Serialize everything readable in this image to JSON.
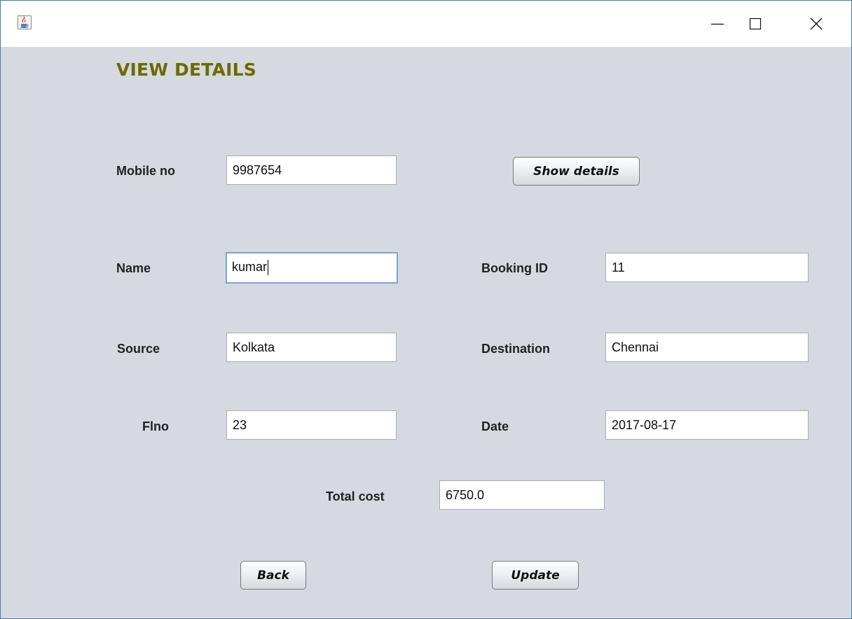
{
  "window": {
    "icon": "java-cup-icon",
    "controls": {
      "minimize": "minimize-icon",
      "maximize": "maximize-icon",
      "close": "close-icon"
    }
  },
  "heading": "VIEW DETAILS",
  "mobile": {
    "label": "Mobile no",
    "value": "9987654"
  },
  "show_details_button": "Show details",
  "name": {
    "label": "Name",
    "value": "kumar"
  },
  "booking_id": {
    "label": "Booking ID",
    "value": "11"
  },
  "source": {
    "label": "Source",
    "value": "Kolkata"
  },
  "destination": {
    "label": "Destination",
    "value": "Chennai"
  },
  "flno": {
    "label": "Flno",
    "value": "23"
  },
  "date": {
    "label": "Date",
    "value": "2017-08-17"
  },
  "total_cost": {
    "label": "Total cost",
    "value": "6750.0"
  },
  "back_button": "Back",
  "update_button": "Update",
  "colors": {
    "heading": "#6b6b00",
    "background": "#d6d9df",
    "focus_border": "#7ea6d4"
  }
}
